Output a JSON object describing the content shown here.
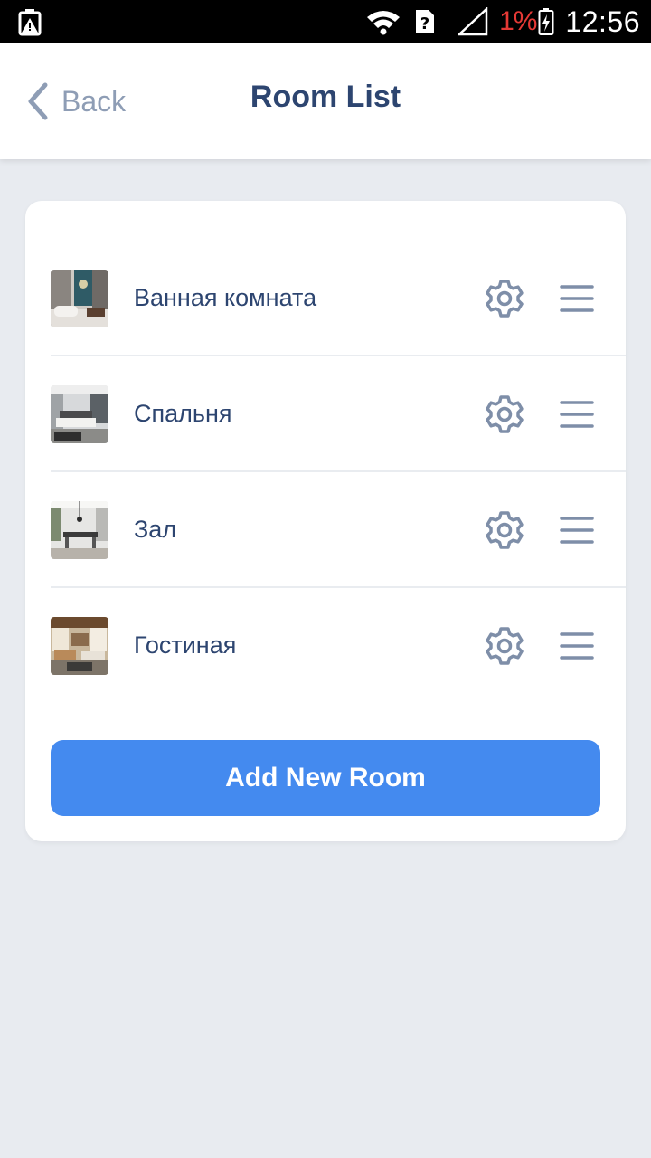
{
  "status_bar": {
    "battery_percent": "1%",
    "clock": "12:56",
    "icons": [
      "battery-alert-icon",
      "wifi-icon",
      "sim-unknown-icon",
      "signal-icon",
      "battery-charging-icon"
    ],
    "battery_pct_color": "#e53935"
  },
  "header": {
    "back_label": "Back",
    "title": "Room List"
  },
  "rooms": [
    {
      "name": "Ванная комната",
      "thumbnail": "bathroom-photo"
    },
    {
      "name": "Спальня",
      "thumbnail": "bedroom-photo"
    },
    {
      "name": "Зал",
      "thumbnail": "hall-photo"
    },
    {
      "name": "Гостиная",
      "thumbnail": "living-room-photo"
    }
  ],
  "actions": {
    "add_room_label": "Add New Room"
  },
  "colors": {
    "accent": "#448aef",
    "title": "#2d4570",
    "icon": "#7e8ea8",
    "background": "#e8ebf0"
  }
}
